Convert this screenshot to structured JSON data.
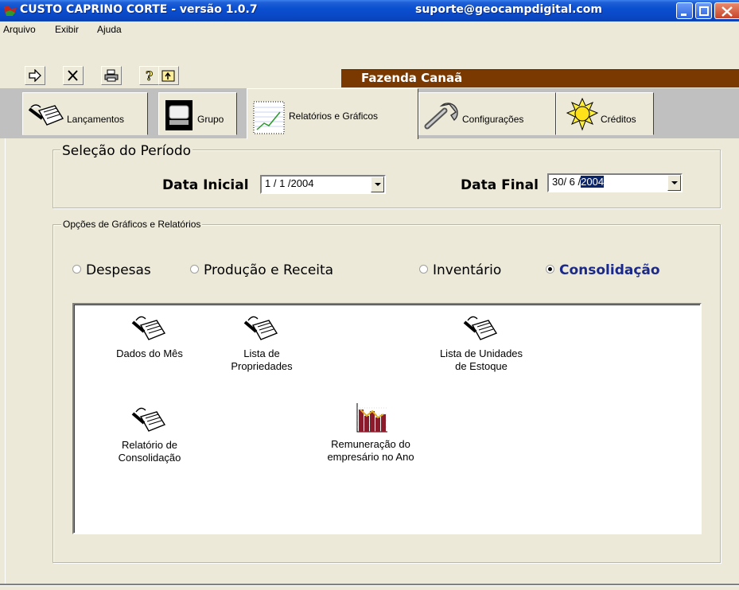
{
  "window": {
    "title": "CUSTO CAPRINO CORTE - versão 1.0.7",
    "email": "suporte@geocampdigital.com"
  },
  "menu": [
    "Arquivo",
    "Exibir",
    "Ajuda"
  ],
  "toolbar": {
    "buttons": [
      "arrow-right-icon",
      "close-x-icon",
      "print-icon",
      "help-icon",
      "up-folder-icon"
    ],
    "farm_name": "Fazenda Canaã"
  },
  "tabs": [
    {
      "label": "Lançamentos",
      "icon": "notepad-pen-icon",
      "active": false
    },
    {
      "label": "Grupo",
      "icon": "group-icon",
      "active": false
    },
    {
      "label": "Relatórios e Gráficos",
      "icon": "line-chart-icon",
      "active": true
    },
    {
      "label": "Configurações",
      "icon": "wrench-icon",
      "active": false
    },
    {
      "label": "Créditos",
      "icon": "sun-icon",
      "active": false
    }
  ],
  "period": {
    "legend": "Seleção do Período",
    "start_label": "Data Inicial",
    "start_value": "1 / 1 /2004",
    "end_label": "Data Final",
    "end_value_prefix": "30/ 6 /",
    "end_value_selected": "2004"
  },
  "options": {
    "legend": "Opções de Gráficos e Relatórios",
    "radios": [
      {
        "label": "Despesas",
        "checked": false
      },
      {
        "label": "Produção e Receita",
        "checked": false
      },
      {
        "label": "Inventário",
        "checked": false
      },
      {
        "label": "Consolidação",
        "checked": true
      }
    ]
  },
  "reports": [
    {
      "label": "Dados do Mês",
      "icon": "notepad-pen-icon"
    },
    {
      "label": "Lista de\nPropriedades",
      "icon": "notepad-pen-icon"
    },
    {
      "label": "Lista de Unidades\nde Estoque",
      "icon": "notepad-pen-icon"
    },
    {
      "label": "Relatório de\nConsolidação",
      "icon": "notepad-pen-icon"
    },
    {
      "label": "Remuneração do\nempresário no Ano",
      "icon": "bar-chart-icon"
    }
  ]
}
